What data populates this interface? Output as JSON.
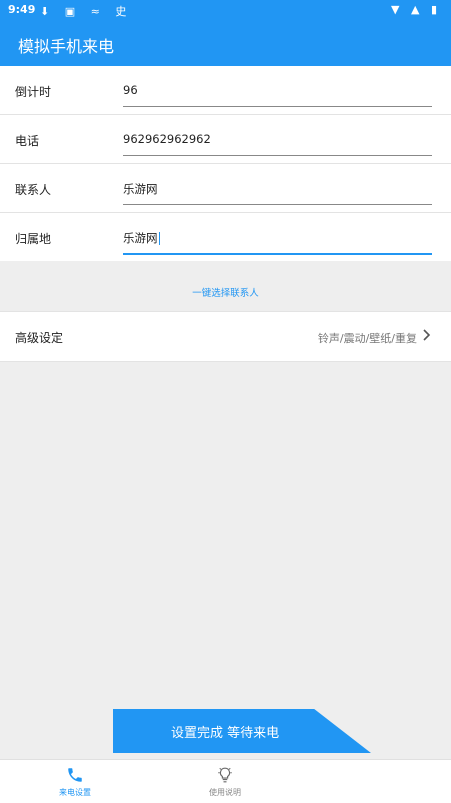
{
  "status_bar": {
    "time": "9:49",
    "icons": "⬇ ▣ ≈ 史",
    "right_icons": "▼ ▲ ▮"
  },
  "app_bar": {
    "title": "模拟手机来电"
  },
  "form": {
    "rows": [
      {
        "label": "倒计时",
        "value": "96"
      },
      {
        "label": "电话",
        "value": "962962962962"
      },
      {
        "label": "联系人",
        "value": "乐游网"
      },
      {
        "label": "归属地",
        "value": "乐游网"
      }
    ]
  },
  "pick_contact": {
    "label": "一键选择联系人"
  },
  "advanced": {
    "label": "高级设定",
    "summary": "铃声/震动/壁纸/重复"
  },
  "submit": {
    "label": "设置完成 等待来电"
  },
  "bottom_nav": {
    "items": [
      {
        "label": "来电设置",
        "icon": "phone-icon",
        "active": true
      },
      {
        "label": "使用说明",
        "icon": "lightbulb-icon",
        "active": false
      }
    ]
  },
  "colors": {
    "primary": "#2196f3",
    "background": "#eeeeee"
  }
}
